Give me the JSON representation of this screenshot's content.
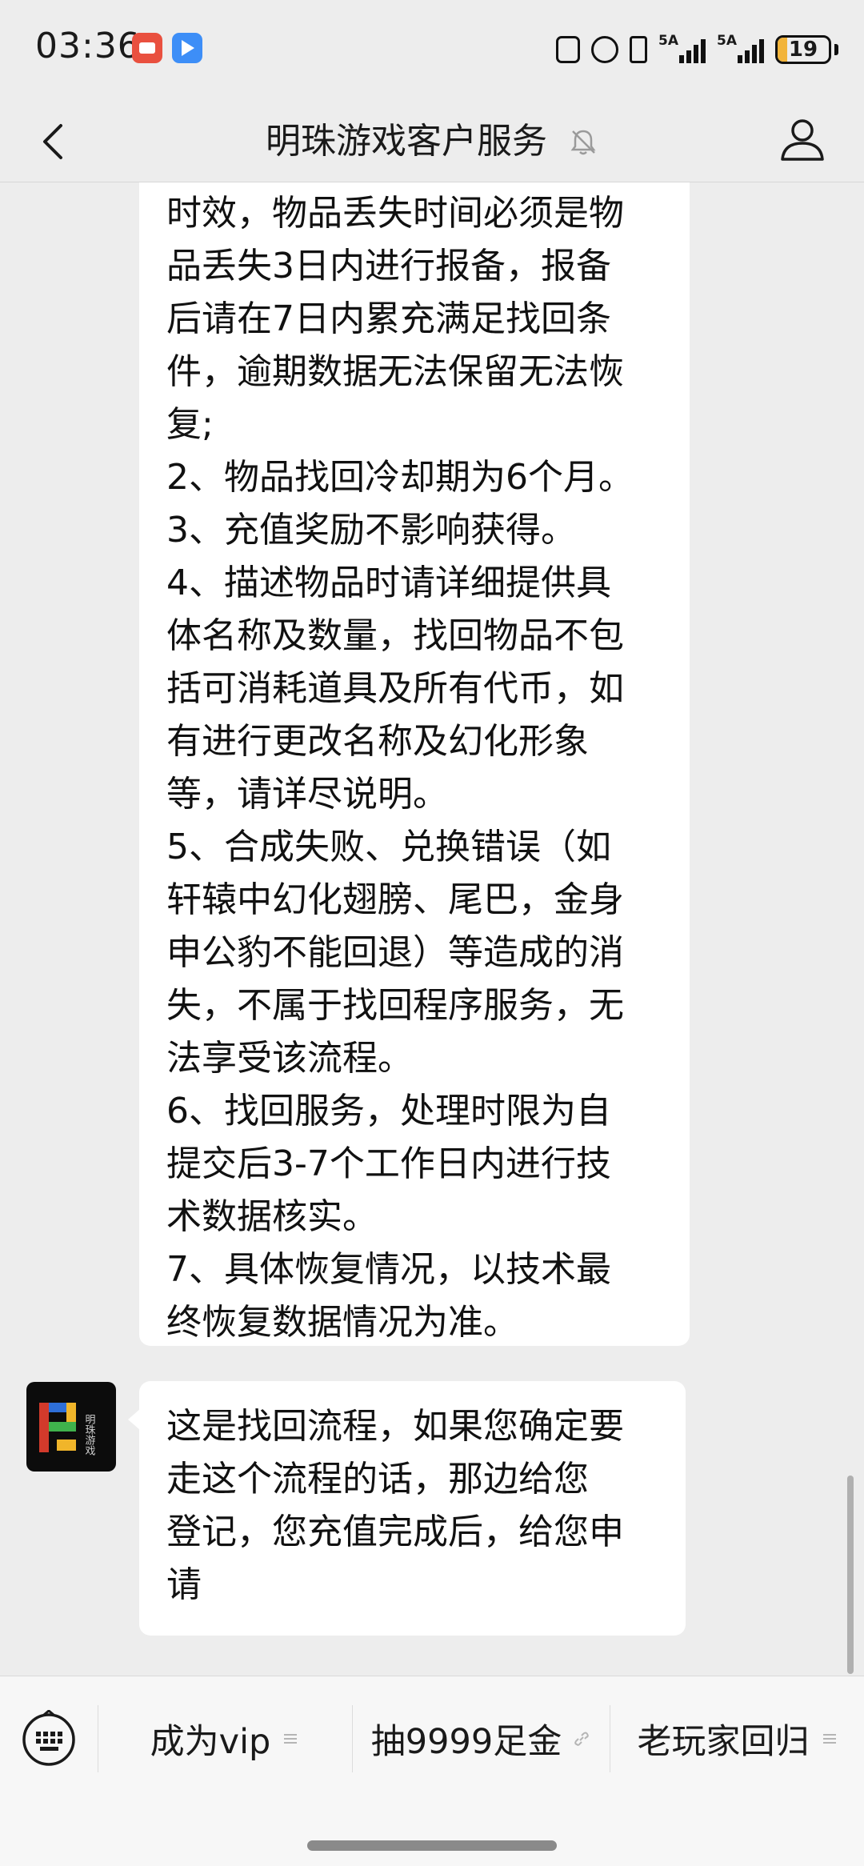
{
  "status_bar": {
    "time": "03:36",
    "app_badges": [
      "video-app-icon",
      "message-app-icon"
    ],
    "signal_labels": [
      "5A",
      "5A"
    ],
    "battery": "19"
  },
  "header": {
    "title": "明珠游戏客户服务",
    "back_icon": "chevron-left-icon",
    "mute_icon": "bell-muted-icon",
    "profile_icon": "person-icon"
  },
  "messages": [
    {
      "sender": "service",
      "text": "时效，物品丢失时间必须是物\n品丢失3日内进行报备，报备\n后请在7日内累充满足找回条\n件，逾期数据无法保留无法恢\n复;\n2、物品找回冷却期为6个月。\n3、充值奖励不影响获得。\n4、描述物品时请详细提供具\n体名称及数量，找回物品不包\n括可消耗道具及所有代币，如\n有进行更改名称及幻化形象\n等，请详尽说明。\n5、合成失败、兑换错误（如\n轩辕中幻化翅膀、尾巴，金身\n申公豹不能回退）等造成的消\n失，不属于找回程序服务，无\n法享受该流程。\n6、找回服务，处理时限为自\n提交后3-7个工作日内进行技\n术数据核实。\n7、具体恢复情况，以技术最\n终恢复数据情况为准。"
    },
    {
      "sender": "service",
      "avatar_text": "明珠游戏",
      "text": "这是找回流程，如果您确定要\n走这个流程的话，那边给您\n登记，您充值完成后，给您申\n请"
    }
  ],
  "bottom_menu": {
    "keyboard_icon": "keyboard-icon",
    "items": [
      {
        "label": "成为vip",
        "icon": "menu-lines-icon"
      },
      {
        "label": "抽9999足金",
        "icon": "link-icon"
      },
      {
        "label": "老玩家回归",
        "icon": "menu-lines-icon"
      }
    ]
  }
}
